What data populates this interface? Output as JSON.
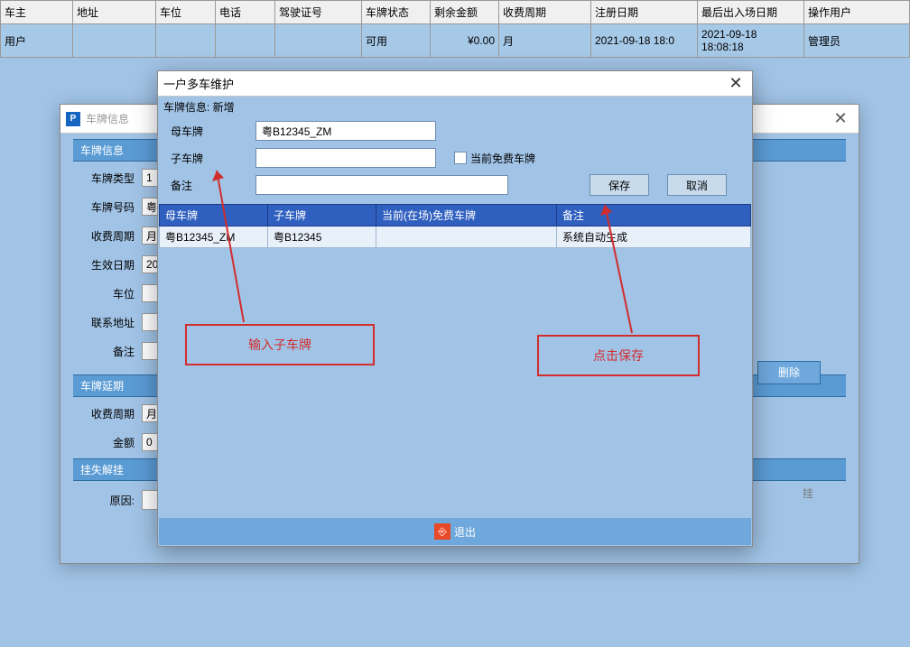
{
  "bg_table": {
    "headers": [
      "车主",
      "地址",
      "车位",
      "电话",
      "驾驶证号",
      "车牌状态",
      "剩余金额",
      "收费周期",
      "注册日期",
      "最后出入场日期",
      "操作用户"
    ],
    "row": {
      "owner": "用户",
      "status": "可用",
      "balance": "¥0.00",
      "cycle": "月",
      "reg_date": "2021-09-18 18:0",
      "last_date": "2021-09-18 18:08:18",
      "operator": "管理员"
    }
  },
  "under_modal": {
    "title": "车牌信息",
    "section1": "车牌信息",
    "labels": {
      "type": "车牌类型",
      "number": "车牌号码",
      "cycle": "收费周期",
      "effdate": "生效日期",
      "slot": "车位",
      "addr": "联系地址",
      "remark": "备注"
    },
    "values": {
      "type": "1",
      "number": "粤",
      "cycle": "月",
      "effdate": "20"
    },
    "section2": "车牌延期",
    "labels2": {
      "cycle": "收费周期",
      "amount": "金额"
    },
    "values2": {
      "cycle": "月",
      "amount": "0"
    },
    "section3": "挂失解挂",
    "reason_label": "原因:",
    "delete_btn": "删除",
    "hang_tail": "挂"
  },
  "top_modal": {
    "title": "一户多车维护",
    "info": "车牌信息: 新增",
    "labels": {
      "parent": "母车牌",
      "child": "子车牌",
      "remark": "备注",
      "cb": "当前免费车牌"
    },
    "values": {
      "parent": "粤B12345_ZM"
    },
    "save": "保存",
    "cancel": "取消",
    "table_headers": [
      "母车牌",
      "子车牌",
      "当前(在场)免费车牌",
      "备注"
    ],
    "table_row": [
      "粤B12345_ZM",
      "粤B12345",
      "",
      "系统自动生成"
    ],
    "exit": "退出"
  },
  "annotations": {
    "left": "输入子车牌",
    "right": "点击保存"
  }
}
